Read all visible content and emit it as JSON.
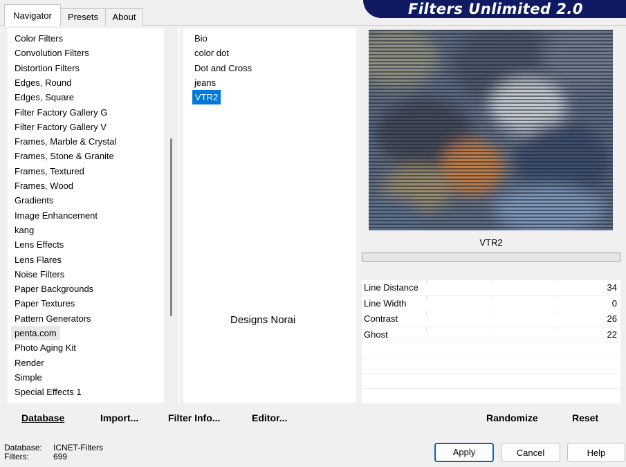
{
  "tabs": [
    "Navigator",
    "Presets",
    "About"
  ],
  "app_title": "Filters Unlimited 2.0",
  "categories": [
    "Color Filters",
    "Convolution Filters",
    "Distortion Filters",
    "Edges, Round",
    "Edges, Square",
    "Filter Factory Gallery G",
    "Filter Factory Gallery V",
    "Frames, Marble & Crystal",
    "Frames, Stone & Granite",
    "Frames, Textured",
    "Frames, Wood",
    "Gradients",
    "Image Enhancement",
    "kang",
    "Lens Effects",
    "Lens Flares",
    "Noise Filters",
    "Paper Backgrounds",
    "Paper Textures",
    "Pattern Generators",
    "penta.com",
    "Photo Aging Kit",
    "Render",
    "Simple",
    "Special Effects 1"
  ],
  "highlighted_category": "penta.com",
  "filters": [
    "Bio",
    "color dot",
    "Dot and Cross",
    "jeans",
    "VTR2"
  ],
  "selected_filter": "VTR2",
  "watermark": "Designs Norai",
  "preview_filter_name": "VTR2",
  "params": [
    {
      "label": "Line Distance",
      "value": "34"
    },
    {
      "label": "Line Width",
      "value": "0"
    },
    {
      "label": "Contrast",
      "value": "26"
    },
    {
      "label": "Ghost",
      "value": "22"
    }
  ],
  "buttons": {
    "database": "Database",
    "import": "Import...",
    "filter_info": "Filter Info...",
    "editor": "Editor...",
    "randomize": "Randomize",
    "reset": "Reset",
    "apply": "Apply",
    "cancel": "Cancel",
    "help": "Help"
  },
  "status": {
    "database_label": "Database:",
    "database_value": "ICNET-Filters",
    "filters_label": "Filters:",
    "filters_value": "699"
  },
  "colors": {
    "banner": "#101a62",
    "selection": "#0078d7"
  }
}
